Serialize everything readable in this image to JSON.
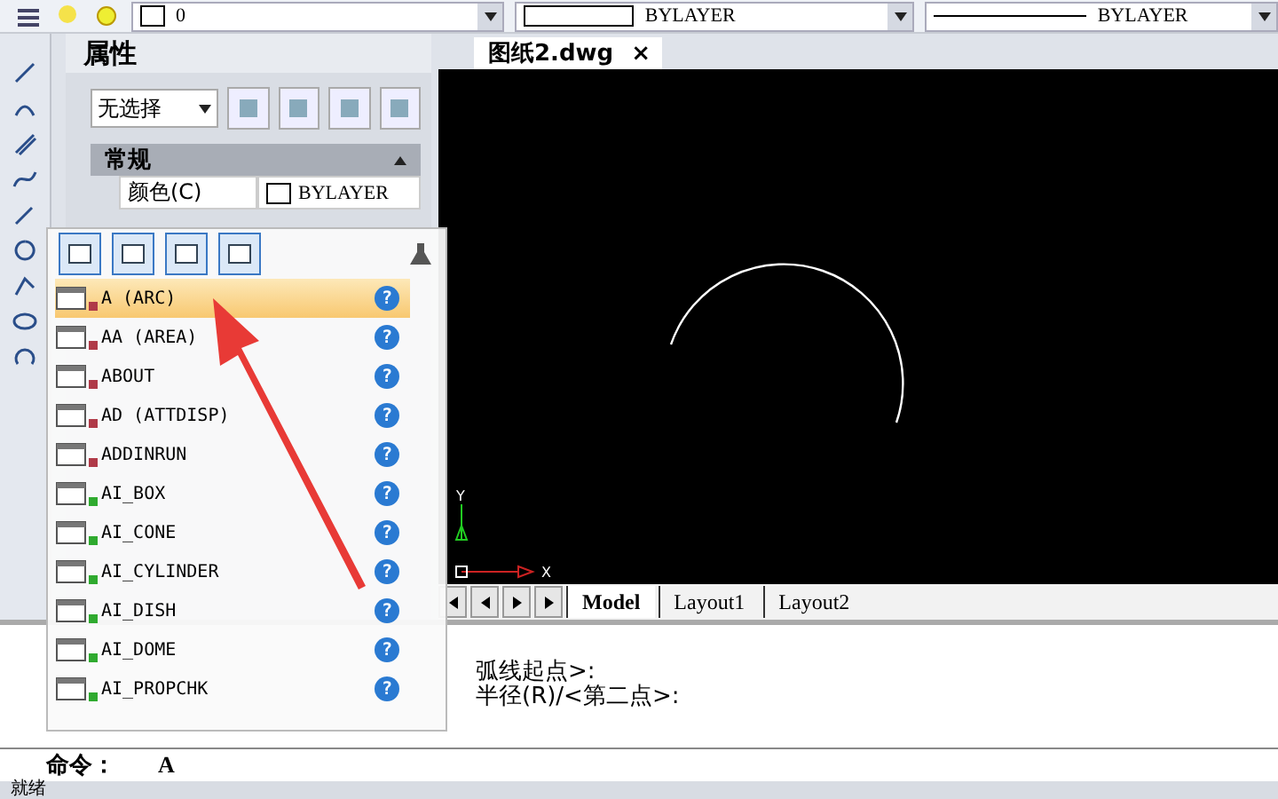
{
  "toolbar": {
    "layer": "0",
    "color_mode": "BYLAYER",
    "linetype": "BYLAYER"
  },
  "properties": {
    "title": "属性",
    "selection": "无选择",
    "section": "常规",
    "rows": [
      {
        "label": "颜色(C)",
        "value": "BYLAYER"
      }
    ]
  },
  "document_tab": {
    "title": "图纸2.dwg",
    "close": "×"
  },
  "layout_tabs": [
    {
      "label": "Model",
      "selected": true
    },
    {
      "label": "Layout1",
      "selected": false
    },
    {
      "label": "Layout2",
      "selected": false
    }
  ],
  "axis": {
    "x": "X",
    "y": "Y"
  },
  "command_history": [
    "弧线起点>:",
    "半径(R)/<第二点>:"
  ],
  "command_line": {
    "prompt": "命令：",
    "value": "A"
  },
  "status_bar": {
    "text": "就绪"
  },
  "popup": {
    "items": [
      {
        "label": "A (ARC)",
        "selected": true,
        "color": "#b03a48",
        "help": "?"
      },
      {
        "label": "AA (AREA)",
        "selected": false,
        "color": "#b03a48",
        "help": "?"
      },
      {
        "label": "ABOUT",
        "selected": false,
        "color": "#b03a48",
        "help": "?"
      },
      {
        "label": "AD (ATTDISP)",
        "selected": false,
        "color": "#b03a48",
        "help": "?"
      },
      {
        "label": "ADDINRUN",
        "selected": false,
        "color": "#b03a48",
        "help": "?"
      },
      {
        "label": "AI_BOX",
        "selected": false,
        "color": "#2faa2f",
        "help": "?"
      },
      {
        "label": "AI_CONE",
        "selected": false,
        "color": "#2faa2f",
        "help": "?"
      },
      {
        "label": "AI_CYLINDER",
        "selected": false,
        "color": "#2faa2f",
        "help": "?"
      },
      {
        "label": "AI_DISH",
        "selected": false,
        "color": "#2faa2f",
        "help": "?"
      },
      {
        "label": "AI_DOME",
        "selected": false,
        "color": "#2faa2f",
        "help": "?"
      },
      {
        "label": "AI_PROPCHK",
        "selected": false,
        "color": "#2faa2f",
        "help": "?"
      }
    ]
  }
}
